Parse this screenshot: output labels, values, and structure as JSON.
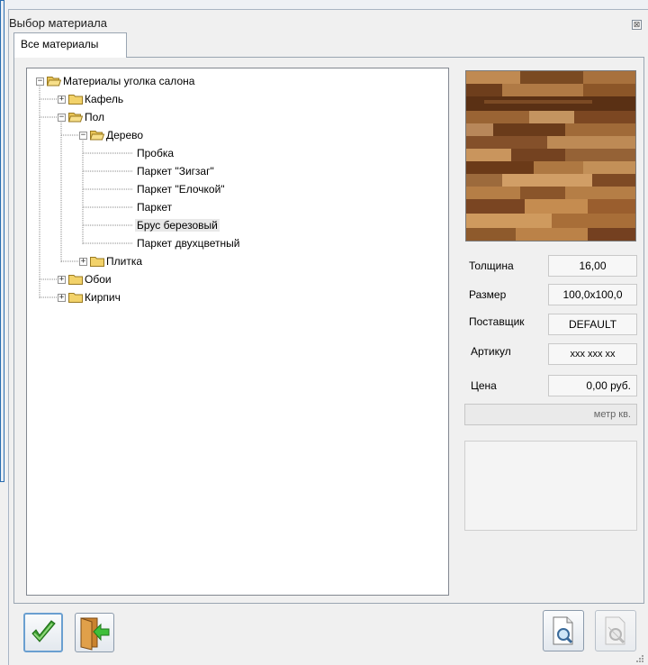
{
  "dialog": {
    "title": "Выбор материала",
    "close_glyph": "⊠"
  },
  "tabs": [
    {
      "label": "Все материалы",
      "active": true
    }
  ],
  "tree": {
    "root": "Материалы уголка салона",
    "items": [
      {
        "label": "Кафель",
        "type": "folder",
        "expanded": false
      },
      {
        "label": "Пол",
        "type": "folder",
        "expanded": true
      },
      {
        "label": "Дерево",
        "type": "folder",
        "expanded": true
      },
      {
        "label": "Пробка",
        "type": "leaf"
      },
      {
        "label": "Паркет \"Зигзаг\"",
        "type": "leaf"
      },
      {
        "label": "Паркет \"Елочкой\"",
        "type": "leaf"
      },
      {
        "label": "Паркет",
        "type": "leaf"
      },
      {
        "label": "Брус березовый",
        "type": "leaf",
        "selected": true
      },
      {
        "label": "Паркет двухцветный",
        "type": "leaf"
      },
      {
        "label": "Плитка",
        "type": "folder",
        "expanded": false
      },
      {
        "label": "Обои",
        "type": "folder",
        "expanded": false
      },
      {
        "label": "Кирпич",
        "type": "folder",
        "expanded": false
      }
    ]
  },
  "properties": {
    "thickness_label": "Толщина",
    "thickness_value": "16,00",
    "size_label": "Размер",
    "size_value": "100,0x100,0",
    "supplier_label": "Поставщик",
    "supplier_value": "DEFAULT",
    "article_label": "Артикул",
    "article_value": "xxx xxx xx",
    "price_label": "Цена",
    "price_value": "0,00 руб.",
    "unit_value": "метр кв."
  },
  "icons": {
    "ok": "checkmark-icon",
    "exit": "door-exit-icon",
    "preview": "document-magnifier-icon",
    "preview_disabled": "document-magnifier-disabled-icon"
  },
  "colors": {
    "checkmark": "#3a9b2f",
    "door": "#c9822e",
    "exit_arrow": "#3fbf3a",
    "folder": "#f2d26a"
  }
}
